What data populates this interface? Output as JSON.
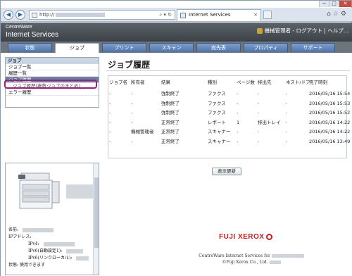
{
  "browser": {
    "url_prefix": "http://",
    "search_icon": "search-icon",
    "tab_title": "Internet Services",
    "tab_close": "×",
    "win_controls": [
      "─",
      "□",
      "✕"
    ]
  },
  "header": {
    "brand_line1": "CentreWare",
    "brand_line2": "Internet Services",
    "user": "機械管理者 - ログアウト | ヘルプ..."
  },
  "tabs": [
    "状態",
    "ジョブ",
    "プリント",
    "スキャン",
    "宛先表",
    "プロパティ",
    "サポート"
  ],
  "sidebar": {
    "items": [
      {
        "label": "ジョブ",
        "type": "head"
      },
      {
        "label": "ジョブ一覧",
        "type": "item"
      },
      {
        "label": "履歴一覧",
        "type": "item"
      },
      {
        "label": "ジョブ履歴",
        "type": "sel"
      },
      {
        "label": "ジョブ履歴(複数ジョブのまとめ)",
        "type": "sub"
      },
      {
        "label": "エラー履歴",
        "type": "item"
      }
    ]
  },
  "device": {
    "name_label": "名前:",
    "ip_label": "IPアドレス:",
    "ipv4_label": "IPv4:",
    "ipv6auto_label": "IPv6(自動設定1):",
    "ipv6link_label": "IPv6(リンクローカル):",
    "status_label": "状態:",
    "status_value": "使用できます"
  },
  "main": {
    "title": "ジョブ履歴",
    "columns": [
      "ジョブ名",
      "所有者",
      "結果",
      "種別",
      "ページ数",
      "排出先",
      "ネスト/ドア",
      "完了時刻"
    ],
    "rows": [
      [
        "-",
        "-",
        "強制終了",
        "ファクス",
        "-",
        "-",
        "-",
        "2016/05/16 15:54"
      ],
      [
        "-",
        "-",
        "強制終了",
        "ファクス",
        "-",
        "-",
        "-",
        "2016/05/16 15:53"
      ],
      [
        "-",
        "-",
        "強制終了",
        "ファクス",
        "-",
        "-",
        "-",
        "2016/05/16 15:52"
      ],
      [
        "-",
        "-",
        "正常終了",
        "レポート",
        "1",
        "排出トレイ",
        "-",
        "2016/05/16 14:22"
      ],
      [
        "-",
        "機械管理者",
        "正常終了",
        "スキャナー",
        "-",
        "-",
        "-",
        "2016/05/16 14:22"
      ],
      [
        "-",
        "-",
        "正常終了",
        "スキャナー",
        "-",
        "-",
        "-",
        "2016/05/16 13:49"
      ]
    ],
    "refresh_label": "表示更新"
  },
  "footer": {
    "logo": "FUJI XEROX",
    "line1": "CentreWare Internet Services for",
    "line2": "©Fuji Xerox Co., Ltd."
  }
}
